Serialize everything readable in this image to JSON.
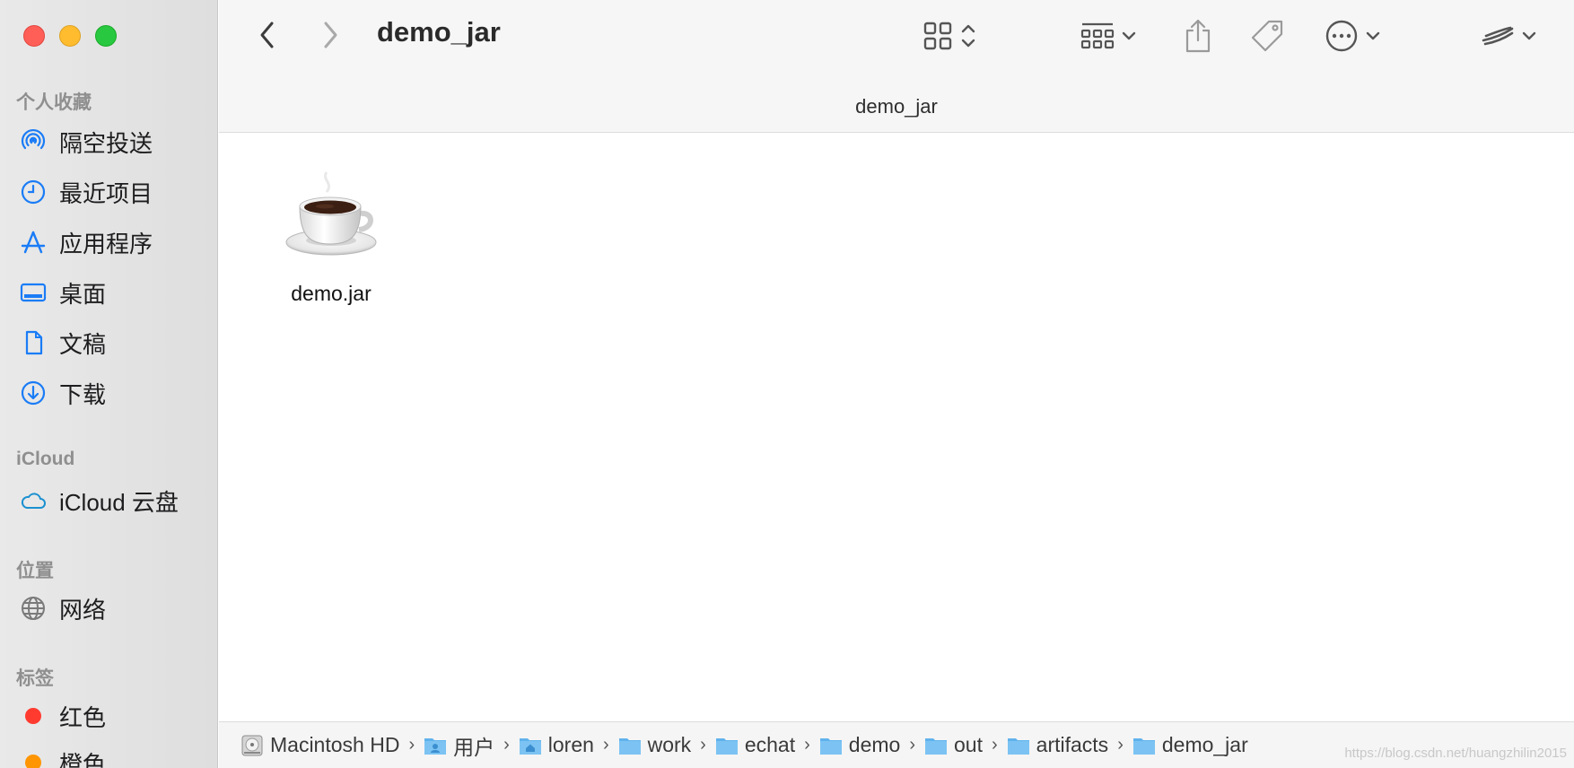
{
  "window": {
    "title": "demo_jar",
    "path_title": "demo_jar"
  },
  "sidebar": {
    "favorites_title": "个人收藏",
    "favorites": [
      {
        "label": "隔空投送",
        "icon": "airdrop-icon"
      },
      {
        "label": "最近项目",
        "icon": "clock-icon"
      },
      {
        "label": "应用程序",
        "icon": "apps-icon"
      },
      {
        "label": "桌面",
        "icon": "desktop-icon"
      },
      {
        "label": "文稿",
        "icon": "document-icon"
      },
      {
        "label": "下载",
        "icon": "download-icon"
      }
    ],
    "icloud_title": "iCloud",
    "icloud": [
      {
        "label": "iCloud 云盘",
        "icon": "cloud-icon"
      }
    ],
    "locations_title": "位置",
    "locations": [
      {
        "label": "网络",
        "icon": "globe-icon"
      }
    ],
    "tags_title": "标签",
    "tags": [
      {
        "label": "红色",
        "color": "#ff3b30"
      },
      {
        "label": "橙色",
        "color": "#ff9500"
      }
    ]
  },
  "files": [
    {
      "name": "demo.jar",
      "icon": "java-coffee-icon"
    }
  ],
  "pathbar": {
    "items": [
      {
        "label": "Macintosh HD",
        "icon": "harddisk-icon"
      },
      {
        "label": "用户",
        "icon": "users-folder-icon"
      },
      {
        "label": "loren",
        "icon": "home-folder-icon"
      },
      {
        "label": "work",
        "icon": "folder-icon"
      },
      {
        "label": "echat",
        "icon": "folder-icon"
      },
      {
        "label": "demo",
        "icon": "folder-icon"
      },
      {
        "label": "out",
        "icon": "folder-icon"
      },
      {
        "label": "artifacts",
        "icon": "folder-icon"
      },
      {
        "label": "demo_jar",
        "icon": "folder-icon"
      }
    ]
  },
  "watermark": "https://blog.csdn.net/huangzhilin2015",
  "colors": {
    "accent": "#1a7cf6",
    "folder": "#5fb2ec"
  }
}
